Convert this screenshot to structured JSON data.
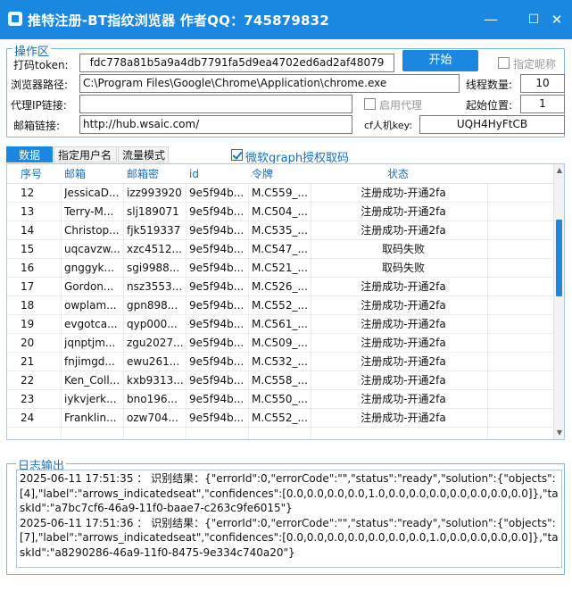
{
  "window": {
    "title": "推特注册-BT指纹浏览器 作者QQ：745879832",
    "min_label": "—",
    "max_label": "☐",
    "close_label": "✕"
  },
  "ops": {
    "legend": "操作区",
    "token_label": "打码token:",
    "token_value": "fdc778a81b5a9a4db7791fa5d9ea4702ed6ad2af48079",
    "start_label": "开始",
    "nick_label": "指定昵称",
    "browser_path_label": "浏览器路径:",
    "browser_path_value": "C:\\Program Files\\Google\\Chrome\\Application\\chrome.exe",
    "threads_label": "线程数量:",
    "threads_value": "10",
    "proxy_label": "代理IP链接:",
    "proxy_value": "",
    "enable_proxy_label": "启用代理",
    "start_pos_label": "起始位置:",
    "start_pos_value": "1",
    "mail_link_label": "邮箱链接:",
    "mail_link_value": "http://hub.wsaic.com/",
    "cf_key_label": "cf人机key:",
    "cf_key_value": "UQH4HyFtCB"
  },
  "tabs": [
    {
      "label": "数据",
      "active": true
    },
    {
      "label": "指定用户名",
      "active": false
    },
    {
      "label": "流量模式",
      "active": false
    }
  ],
  "graph_label": "微软graph授权取码",
  "grid": {
    "columns": [
      "序号",
      "邮箱",
      "邮箱密",
      "id",
      "令牌",
      "状态"
    ],
    "rows": [
      [
        "12",
        "JessicaD...",
        "izz993920",
        "9e5f94b...",
        "M.C559_...",
        "注册成功-开通2fa"
      ],
      [
        "13",
        "Terry-M...",
        "slj189071",
        "9e5f94b...",
        "M.C504_...",
        "注册成功-开通2fa"
      ],
      [
        "14",
        "Christop...",
        "fjk519337",
        "9e5f94b...",
        "M.C535_...",
        "注册成功-开通2fa"
      ],
      [
        "15",
        "uqcavzw...",
        "xzc4512...",
        "9e5f94b...",
        "M.C547_...",
        "取码失败"
      ],
      [
        "16",
        "gnggyk...",
        "sgi9988...",
        "9e5f94b...",
        "M.C521_...",
        "取码失败"
      ],
      [
        "17",
        "Gordon...",
        "nsz3553...",
        "9e5f94b...",
        "M.C526_...",
        "注册成功-开通2fa"
      ],
      [
        "18",
        "owplam...",
        "gpn898...",
        "9e5f94b...",
        "M.C552_...",
        "注册成功-开通2fa"
      ],
      [
        "19",
        "evgotca...",
        "qyp000...",
        "9e5f94b...",
        "M.C561_...",
        "注册成功-开通2fa"
      ],
      [
        "20",
        "jqnptjm...",
        "zgu2027...",
        "9e5f94b...",
        "M.C509_...",
        "注册成功-开通2fa"
      ],
      [
        "21",
        "fnjimgd...",
        "ewu261...",
        "9e5f94b...",
        "M.C532_...",
        "注册成功-开通2fa"
      ],
      [
        "22",
        "Ken_Coll...",
        "kxb9313...",
        "9e5f94b...",
        "M.C558_...",
        "注册成功-开通2fa"
      ],
      [
        "23",
        "iykvjerk...",
        "bno196...",
        "9e5f94b...",
        "M.C550_...",
        "注册成功-开通2fa"
      ],
      [
        "24",
        "Franklin...",
        "ozw704...",
        "9e5f94b...",
        "M.C552_...",
        "注册成功-开通2fa"
      ]
    ]
  },
  "log": {
    "legend": "日志输出",
    "lines": [
      "2025-06-11 17:51:35 ：  识别结果：{\"errorId\":0,\"errorCode\":\"\",\"status\":\"ready\",\"solution\":{\"objects\":[4],\"label\":\"arrows_indicatedseat\",\"confidences\":[0.0,0.0,0.0,0.0,1.0,0.0,0.0,0.0,0.0,0.0,0.0,0.0]},\"taskId\":\"a7bc7cf6-46a9-11f0-baae7-c263c9fe6015\"}",
      "2025-06-11 17:51:36 ：  识别结果：{\"errorId\":0,\"errorCode\":\"\",\"status\":\"ready\",\"solution\":{\"objects\":[7],\"label\":\"arrows_indicatedseat\",\"confidences\":[0.0,0.0,0.0,0.0,0.0,0.0,0.0,1.0,0.0,0.0,0.0,0.0]},\"taskId\":\"a8290286-46a9-11f0-8475-9e334c740a20\"}"
    ]
  },
  "colors": {
    "accent": "#1a88e0",
    "legend": "#1a6fc0"
  }
}
